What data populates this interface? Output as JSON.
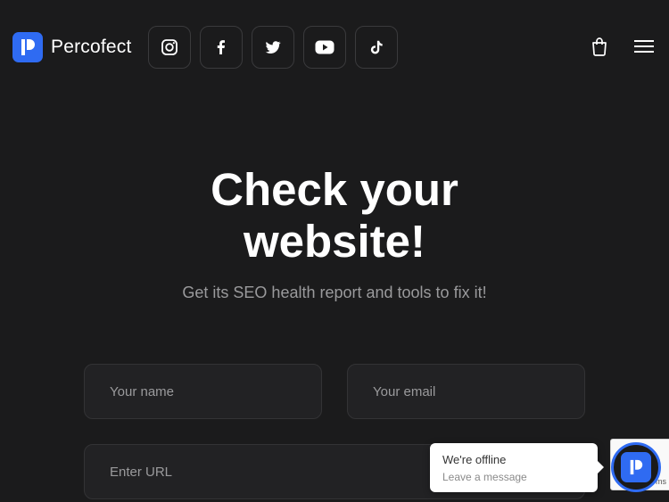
{
  "header": {
    "brand": "Percofect",
    "socials": [
      {
        "name": "instagram-icon"
      },
      {
        "name": "facebook-icon"
      },
      {
        "name": "twitter-icon"
      },
      {
        "name": "youtube-icon"
      },
      {
        "name": "tiktok-icon"
      }
    ],
    "cart_icon": "shopping-bag-icon",
    "menu_icon": "hamburger-menu-icon"
  },
  "hero": {
    "title_line1": "Check your",
    "title_line2": "website!",
    "subtitle": "Get its SEO health report and tools to fix it!"
  },
  "form": {
    "name_placeholder": "Your name",
    "email_placeholder": "Your email",
    "url_placeholder": "Enter URL"
  },
  "chat": {
    "status": "We're offline",
    "cta": "Leave a message"
  },
  "recaptcha": {
    "text": "ms"
  },
  "colors": {
    "background": "#1b1b1c",
    "accent": "#2f6bf2",
    "field_bg": "#222224",
    "muted_text": "#9a9a9c"
  }
}
